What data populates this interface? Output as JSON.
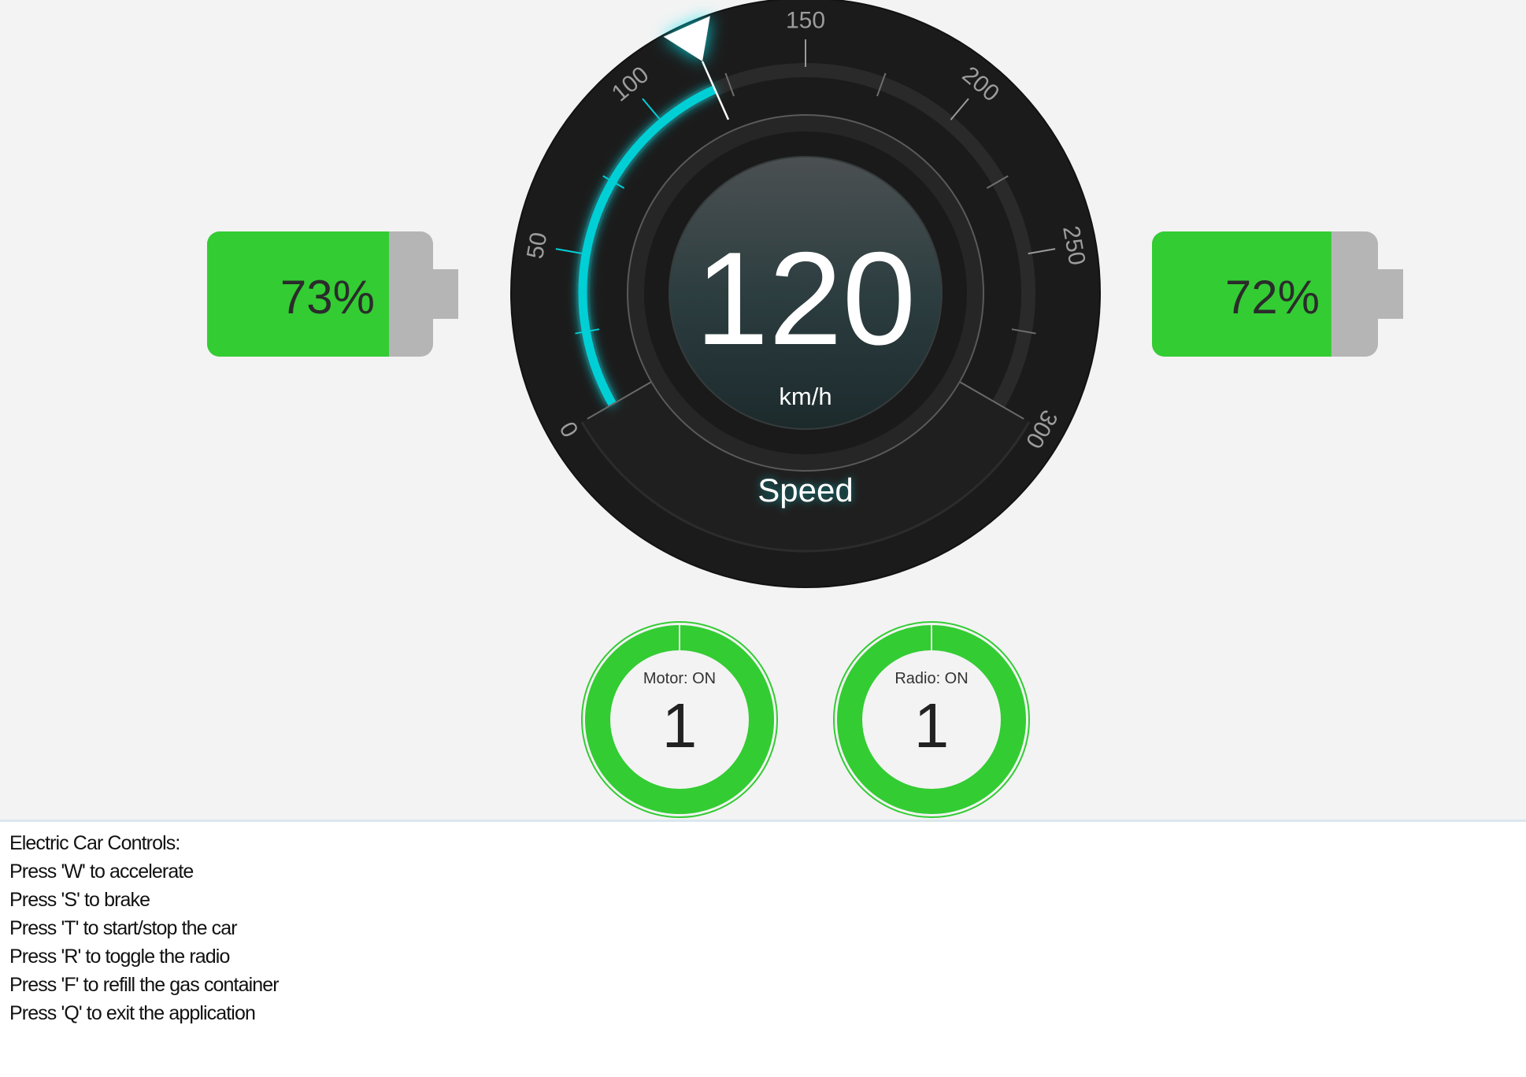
{
  "speedometer": {
    "value": 120,
    "unit": "km/h",
    "label": "Speed",
    "scale": {
      "min": 0,
      "max": 300,
      "major_step": 50,
      "minor_step": 25,
      "labels": [
        "0",
        "50",
        "100",
        "150",
        "200",
        "250",
        "300"
      ]
    }
  },
  "batteries": [
    {
      "level": 73,
      "label": "73%"
    },
    {
      "level": 72,
      "label": "72%"
    }
  ],
  "indicators": [
    {
      "title": "Motor: ON",
      "value": "1",
      "fill": 1
    },
    {
      "title": "Radio: ON",
      "value": "1",
      "fill": 1
    }
  ],
  "controls": {
    "heading": "Electric Car Controls:",
    "lines": [
      "Press 'W' to accelerate",
      "Press 'S' to brake",
      "Press 'T' to start/stop the car",
      "Press 'R' to toggle the radio",
      "Press 'F' to refill the gas container",
      "Press 'Q' to exit the application"
    ]
  },
  "colors": {
    "accent": "#00cfd6",
    "needle": "#ffffff",
    "battery_charge": "#33cc33",
    "battery_body": "#b5b5b5",
    "indicator_on": "#33cc33"
  }
}
